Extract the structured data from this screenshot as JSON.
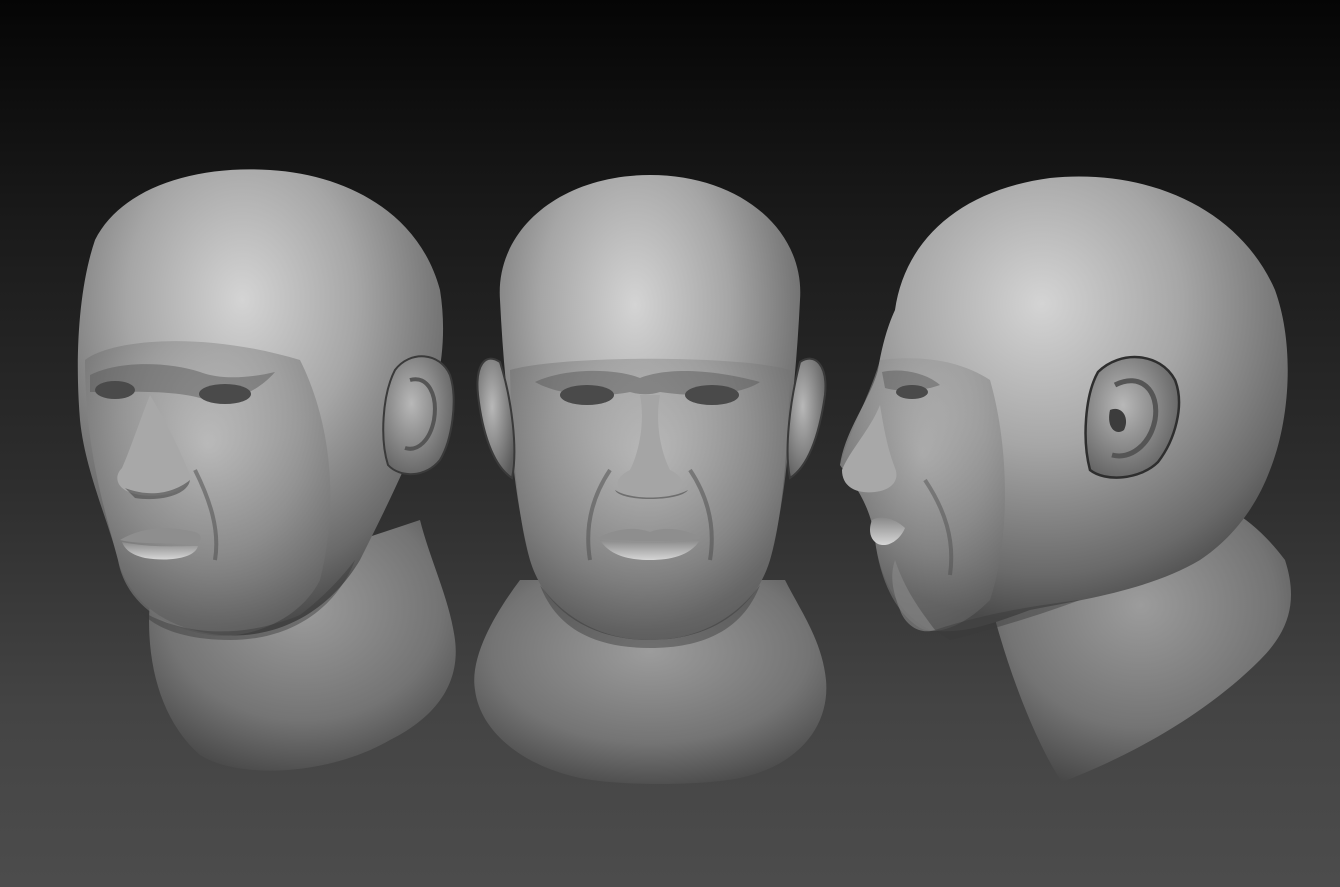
{
  "viewport": {
    "background_top": "#050505",
    "background_bottom": "#4c4c4c"
  },
  "model": {
    "material": "matcap-gray",
    "base_color": "#8a8a8a",
    "highlight_color": "#d8d8d8",
    "shadow_color": "#262626"
  },
  "views": [
    {
      "id": "three-quarter",
      "label": ""
    },
    {
      "id": "front",
      "label": ""
    },
    {
      "id": "profile",
      "label": ""
    }
  ]
}
